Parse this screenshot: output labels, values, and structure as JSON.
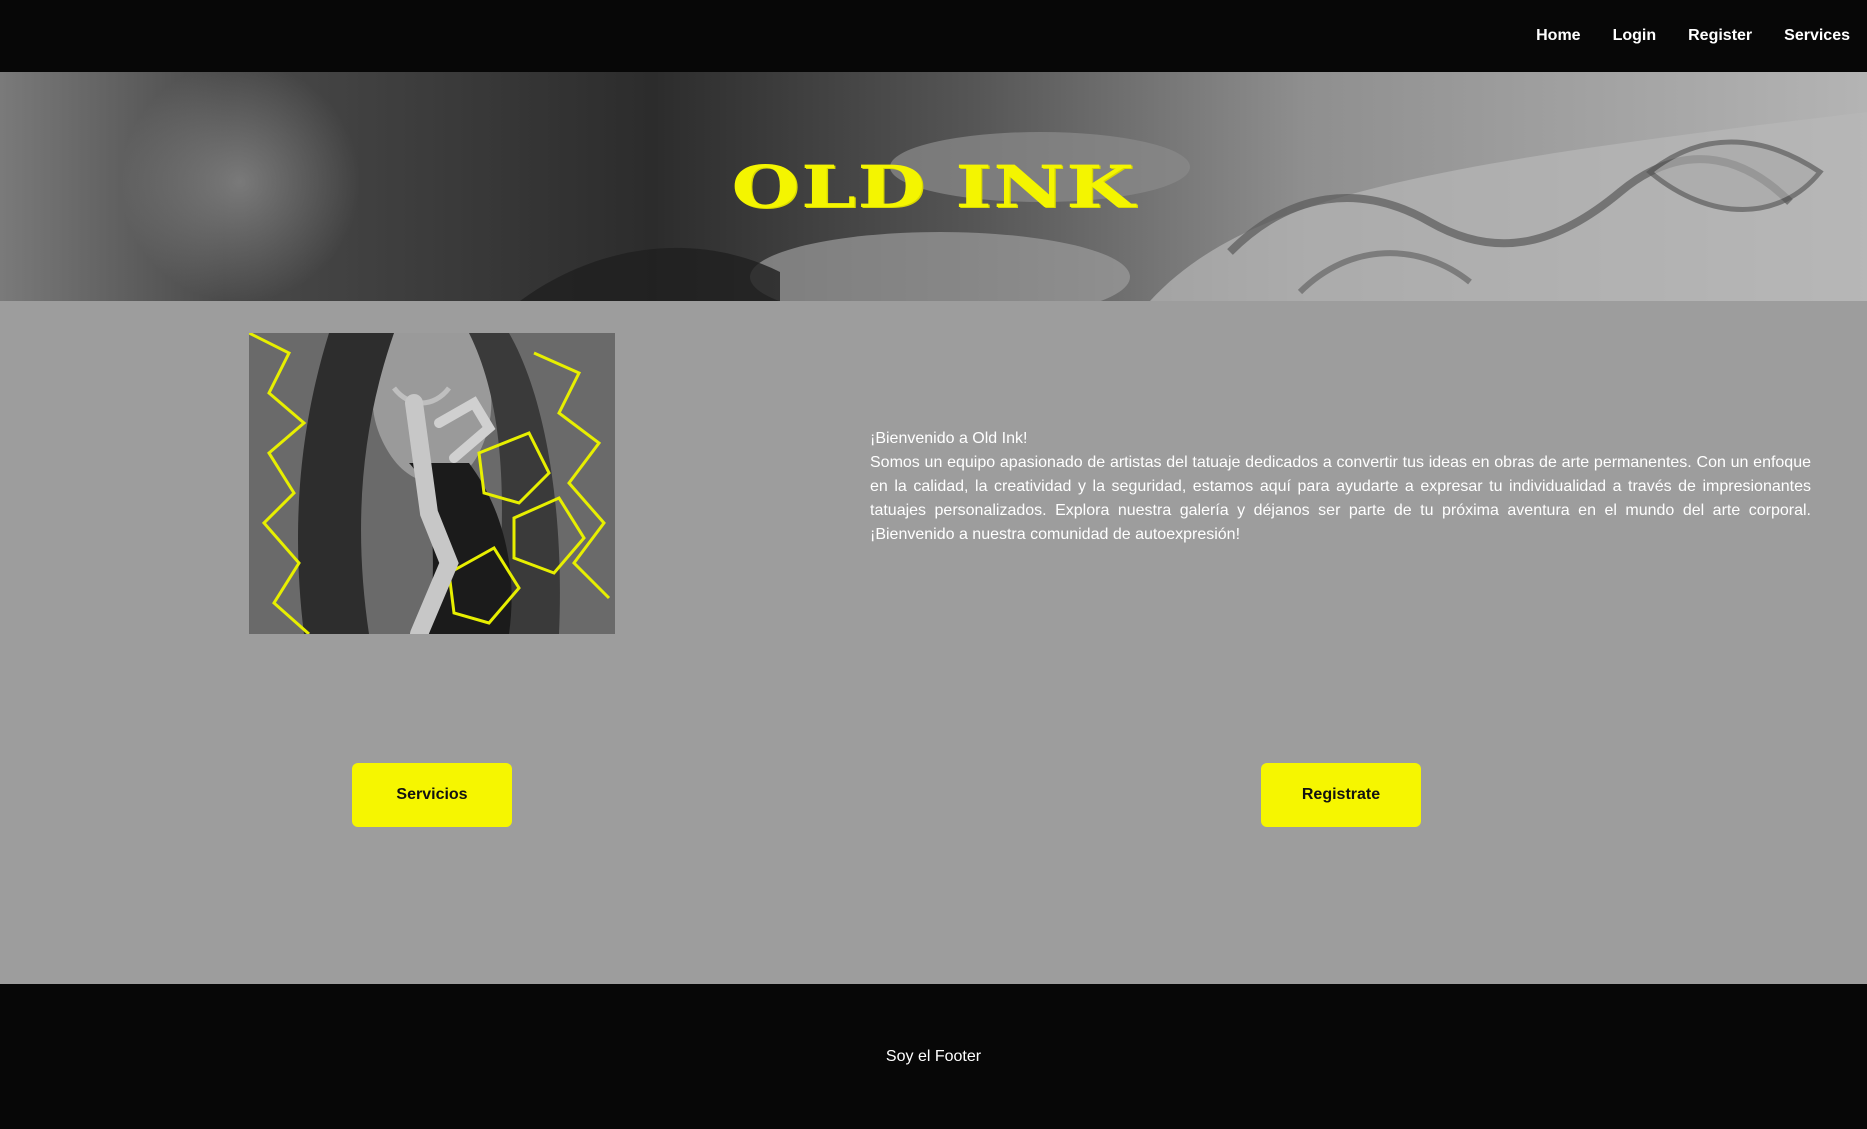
{
  "navbar": {
    "links": [
      "Home",
      "Login",
      "Register",
      "Services"
    ]
  },
  "hero": {
    "title": "OLD INK",
    "image": "tattoo-artist-working-photo",
    "title_color": "#f4f500"
  },
  "main": {
    "image": "woman-with-braids-tattooed-hands-photo",
    "welcome_title": "¡Bienvenido a Old Ink!",
    "welcome_text": "Somos un equipo apasionado de artistas del tatuaje dedicados a convertir tus ideas en obras de arte permanentes. Con un enfoque en la calidad, la creatividad y la seguridad, estamos aquí para ayudarte a expresar tu individualidad a través de impresionantes tatuajes personalizados. Explora nuestra galería y déjanos ser parte de tu próxima aventura en el mundo del arte corporal. ¡Bienvenido a nuestra comunidad de autoexpresión!",
    "buttons": {
      "services": "Servicios",
      "register": "Registrate"
    }
  },
  "footer": {
    "text": "Soy el Footer"
  },
  "colors": {
    "accent": "#f6f600",
    "background": "#9d9d9d",
    "nav_footer": "#070707",
    "text": "#ffffff"
  }
}
